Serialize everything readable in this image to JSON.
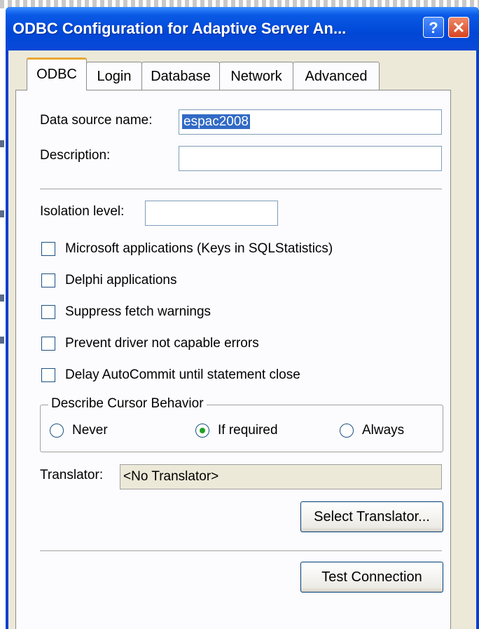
{
  "window": {
    "title": "ODBC Configuration for Adaptive Server An...",
    "help_label": "?",
    "close_label": "✕"
  },
  "tabs": [
    {
      "label": "ODBC",
      "active": true
    },
    {
      "label": "Login",
      "active": false
    },
    {
      "label": "Database",
      "active": false
    },
    {
      "label": "Network",
      "active": false
    },
    {
      "label": "Advanced",
      "active": false
    }
  ],
  "form": {
    "dsn_label": "Data source name:",
    "dsn_value": "espac2008",
    "description_label": "Description:",
    "description_value": "",
    "isolation_label": "Isolation level:",
    "isolation_value": ""
  },
  "options": [
    {
      "label": "Microsoft applications (Keys in SQLStatistics)",
      "checked": false
    },
    {
      "label": "Delphi applications",
      "checked": false
    },
    {
      "label": "Suppress fetch warnings",
      "checked": false
    },
    {
      "label": "Prevent driver not capable errors",
      "checked": false
    },
    {
      "label": "Delay AutoCommit until statement close",
      "checked": false
    }
  ],
  "cursor": {
    "legend": "Describe Cursor Behavior",
    "choices": [
      {
        "label": "Never",
        "selected": false
      },
      {
        "label": "If required",
        "selected": true
      },
      {
        "label": "Always",
        "selected": false
      }
    ]
  },
  "translator": {
    "label": "Translator:",
    "value": "<No Translator>",
    "select_button": "Select Translator..."
  },
  "test_button": "Test Connection",
  "colors": {
    "titlebar": "#0047d6",
    "selection": "#316ac5",
    "tab_highlight": "#e8a834"
  }
}
